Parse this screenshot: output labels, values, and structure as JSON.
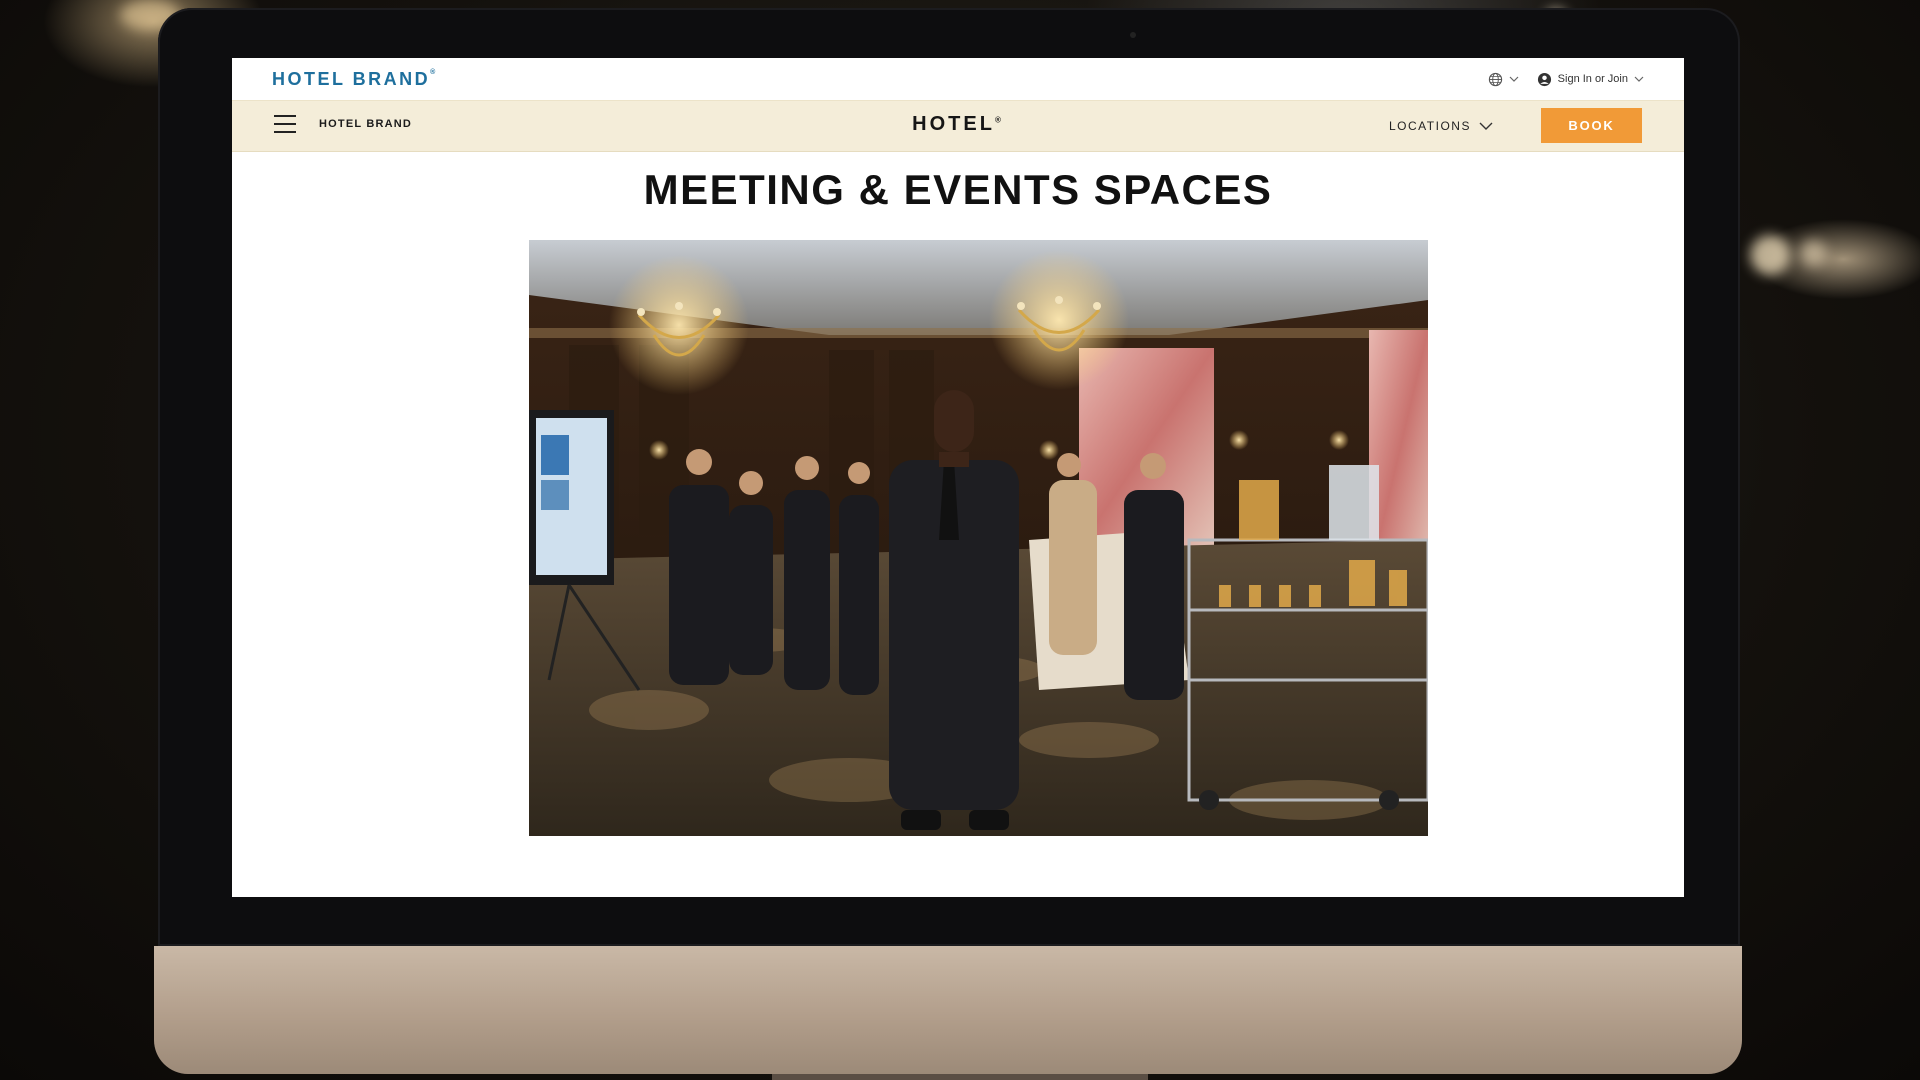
{
  "topbar": {
    "brand_logo": "HOTEL BRAND",
    "brand_mark": "®",
    "language_icon": "globe-icon",
    "account_label": "Sign In or Join",
    "account_icon": "user-circle-icon"
  },
  "navbar": {
    "menu_icon": "hamburger-icon",
    "brand_label": "HOTEL BRAND",
    "hotel_logo": "HOTEL",
    "hotel_mark": "®",
    "locations_label": "LOCATIONS",
    "book_label": "BOOK"
  },
  "main": {
    "title": "MEETING & EVENTS SPACES"
  },
  "colors": {
    "brand_blue": "#1e6f9d",
    "nav_background": "#f4edd9",
    "book_button": "#f19a37"
  }
}
